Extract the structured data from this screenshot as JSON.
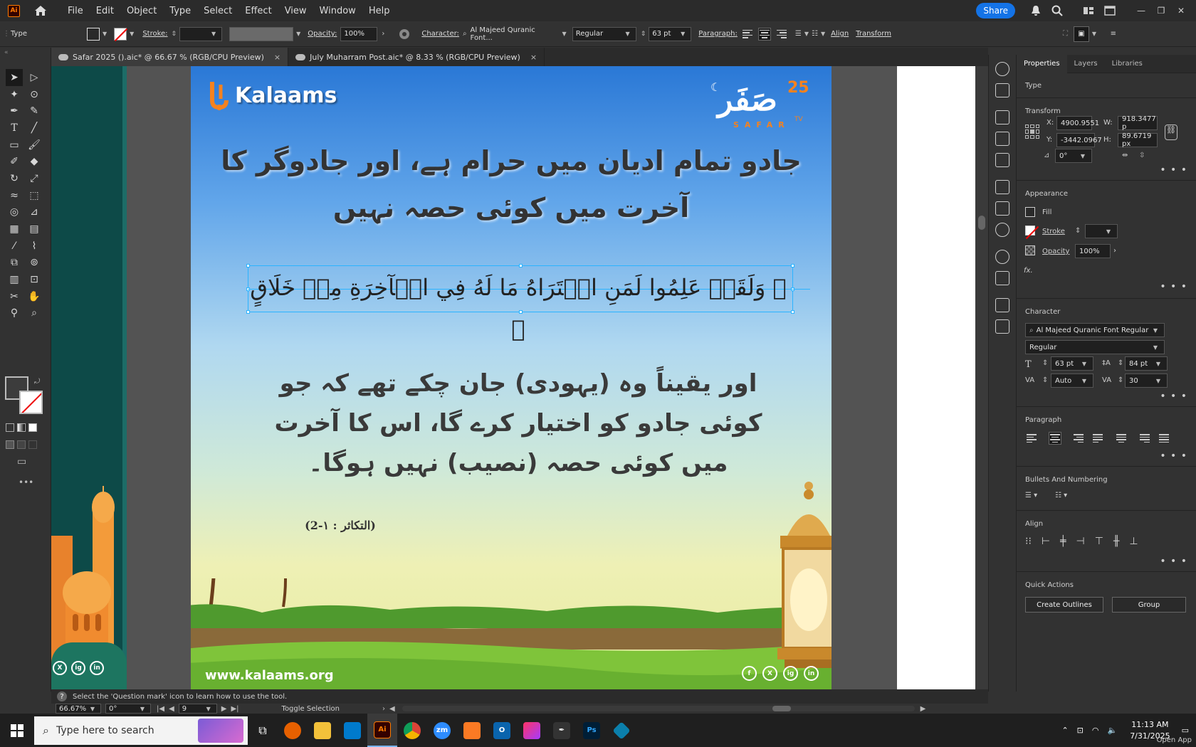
{
  "menubar": {
    "app_badge": "Ai",
    "items": [
      "File",
      "Edit",
      "Object",
      "Type",
      "Select",
      "Effect",
      "View",
      "Window",
      "Help"
    ],
    "share": "Share"
  },
  "control": {
    "tool": "Type",
    "stroke_label": "Stroke:",
    "opacity_label": "Opacity:",
    "opacity_value": "100%",
    "character_label": "Character:",
    "font": "Al Majeed Quranic Font...",
    "style": "Regular",
    "size": "63 pt",
    "paragraph_label": "Paragraph:",
    "align_link": "Align",
    "transform_link": "Transform"
  },
  "tabs": [
    {
      "label": "Safar 2025 ().aic* @ 66.67 % (RGB/CPU Preview)",
      "close": "×"
    },
    {
      "label": "July Muharram Post.aic* @ 8.33 % (RGB/CPU Preview)",
      "close": "×"
    }
  ],
  "artboard": {
    "brand": "Kalaams",
    "safar_ar": "صَفَر",
    "safar_num": "25",
    "safar_en": "SAFAR",
    "safar_tv": "TV",
    "heading": "جادو تمام ادیان میں حرام ہے، اور جادوگر کا آخرت میں کوئی حصہ نہیں",
    "ayah": "﴿ وَلَقَدۡ عَلِمُوا لَمَنِ اشۡتَرَاهُ مَا لَهُ فِي الۡآخِرَةِ مِنۡ خَلَاقٍ ﴾",
    "translation": "اور یقیناً وہ (یہودی) جان چکے تھے کہ جو کوئی جادو کو اختیار کرے گا، اس کا آخرت میں کوئی حصہ (نصیب) نہیں ہوگا۔",
    "reference": "(التكاثر : ١-2)",
    "website": "www.kalaams.org",
    "social": [
      "f",
      "X",
      "ig",
      "in"
    ]
  },
  "left_social": [
    "X",
    "ig",
    "in"
  ],
  "panel": {
    "tabs": [
      "Properties",
      "Layers",
      "Libraries"
    ],
    "type_section": "Type",
    "transform_section": "Transform",
    "x_label": "X:",
    "x_value": "4900.9551",
    "y_label": "Y:",
    "y_value": "-3442.0967",
    "w_label": "W:",
    "w_value": "918.3477 p",
    "h_label": "H:",
    "h_value": "89.6719 px",
    "angle": "0°",
    "appearance_section": "Appearance",
    "fill": "Fill",
    "stroke": "Stroke",
    "opacity": "Opacity",
    "opacity_value": "100%",
    "fx": "fx.",
    "character_section": "Character",
    "font": "Al Majeed Quranic Font Regular",
    "style": "Regular",
    "size": "63 pt",
    "leading": "84 pt",
    "kerning": "Auto",
    "tracking": "30",
    "paragraph_section": "Paragraph",
    "bullets_section": "Bullets And Numbering",
    "align_section": "Align",
    "quick_actions": "Quick Actions",
    "create_outlines": "Create Outlines",
    "group": "Group",
    "more": "• • •"
  },
  "status": {
    "tip": "Select the 'Question mark' icon to learn how to use the tool.",
    "zoom": "66.67%",
    "rotation": "0°",
    "artboard_num": "9",
    "toggle": "Toggle Selection"
  },
  "taskbar": {
    "search_placeholder": "Type here to search",
    "time": "11:13 AM",
    "date": "7/31/2025",
    "open_app": "Open App",
    "apps": [
      "firefox",
      "file-explorer",
      "vscode",
      "illustrator",
      "chrome",
      "zoom",
      "xampp",
      "outlook",
      "creative-cloud",
      "inkscape",
      "photoshop",
      "app"
    ]
  },
  "colors": {
    "accent_blue": "#1473e6",
    "brand_orange": "#f5821f",
    "selection": "#2bb3ff"
  }
}
